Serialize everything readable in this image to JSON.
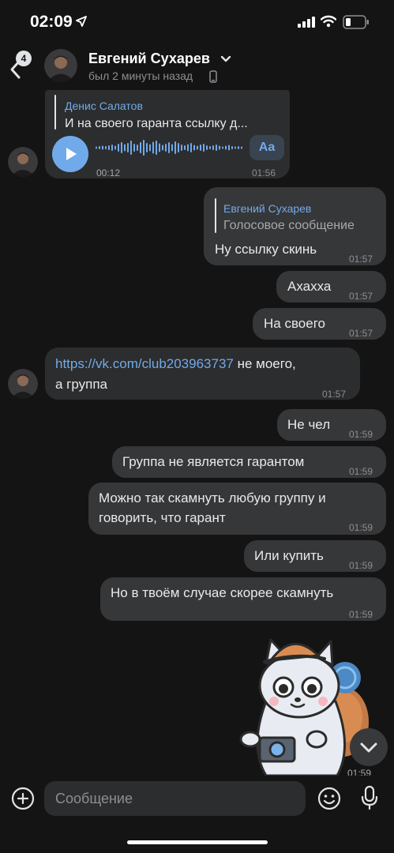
{
  "status_bar": {
    "time": "02:09"
  },
  "header": {
    "unread_count": "4",
    "contact_name": "Евгений Сухарев",
    "last_seen": "был 2 минуты назад"
  },
  "messages": [
    {
      "direction": "incoming",
      "type": "voice",
      "reply_author": "Денис Салатов",
      "reply_text": "И на своего гаранта ссылку д...",
      "duration": "00:12",
      "transcribe_label": "Aa",
      "time": "01:56"
    },
    {
      "direction": "outgoing",
      "reply_author": "Евгений Сухарев",
      "reply_text": "Голосовое сообщение",
      "text": "Ну ссылку скинь",
      "time": "01:57"
    },
    {
      "direction": "outgoing",
      "text": "Ахахха",
      "time": "01:57"
    },
    {
      "direction": "outgoing",
      "text": "На своего",
      "time": "01:57"
    },
    {
      "direction": "incoming",
      "link": "https://vk.com/club203963737",
      "text_after_link": " не моего,",
      "text_line2": "а группа",
      "time": "01:57"
    },
    {
      "direction": "outgoing",
      "text": "Не чел",
      "time": "01:59"
    },
    {
      "direction": "outgoing",
      "text": "Группа не является гарантом",
      "time": "01:59"
    },
    {
      "direction": "outgoing",
      "text_line1": "Можно так скамнуть любую группу и",
      "text_line2": "говорить, что гарант",
      "time": "01:59"
    },
    {
      "direction": "outgoing",
      "text": "Или купить",
      "time": "01:59"
    },
    {
      "direction": "outgoing",
      "text": "Но в твоём случае скорее скамнуть",
      "time": "01:59"
    },
    {
      "direction": "outgoing",
      "type": "sticker",
      "sticker": "cat-traveler-with-camera",
      "time": "01:59"
    }
  ],
  "composer": {
    "placeholder": "Сообщение"
  },
  "colors": {
    "background": "#141414",
    "incoming_bubble": "#2c2d2e",
    "outgoing_bubble": "#363738",
    "accent": "#71aaeb",
    "time_text": "#8e8e93"
  },
  "icons": [
    "location-arrow-icon",
    "signal-icon",
    "wifi-icon",
    "battery-icon",
    "back-chevron-icon",
    "chevron-down-icon",
    "phone-icon",
    "play-icon",
    "arrow-down-icon",
    "plus-circle-icon",
    "emoji-icon",
    "microphone-icon"
  ]
}
